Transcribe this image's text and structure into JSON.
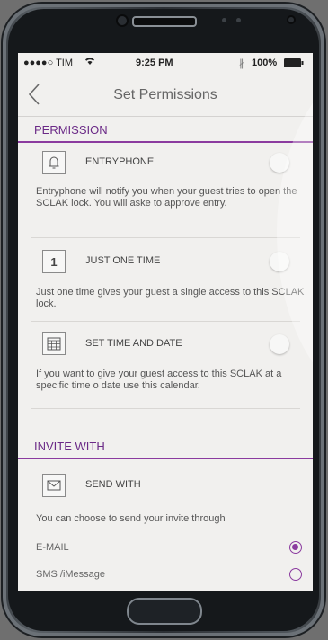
{
  "status_bar": {
    "carrier": "●●●●○ TIM",
    "time": "9:25 PM",
    "battery": "100%"
  },
  "nav": {
    "title": "Set Permissions"
  },
  "permission": {
    "heading": "PERMISSION",
    "options": [
      {
        "icon": "bell-icon",
        "label": "ENTRYPHONE",
        "desc": "Entryphone will notify you when your guest tries to open the SCLAK lock. You will aske to approve entry."
      },
      {
        "icon": "number-one-icon",
        "icon_text": "1",
        "label": "JUST ONE TIME",
        "desc": "Just one time gives your guest a single access to this SCLAK lock."
      },
      {
        "icon": "calendar-icon",
        "label": "SET TIME AND DATE",
        "desc": "If you want to give your guest access to this SCLAK at a specific time o date  use this calendar."
      }
    ]
  },
  "invite": {
    "heading": "INVITE WITH",
    "send_with": {
      "icon": "envelope-icon",
      "label": "SEND WITH"
    },
    "desc": "You can choose to send your invite through",
    "methods": [
      {
        "label": "E-MAIL",
        "selected": true
      },
      {
        "label": "SMS /iMessage",
        "selected": false
      }
    ]
  },
  "colors": {
    "accent": "#8b3b9f",
    "screen_bg": "#f1f0ee"
  }
}
